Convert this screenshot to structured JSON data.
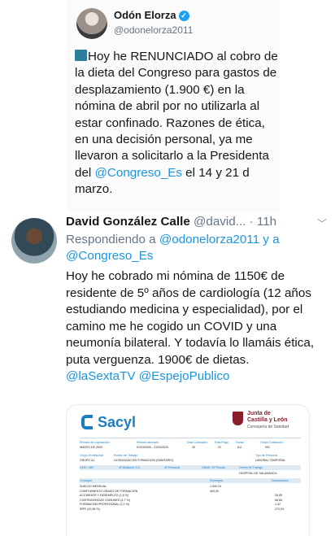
{
  "tweet1": {
    "name": "Odón Elorza",
    "verified": true,
    "handle": "@odonelorza2011",
    "text_before_mention": "Hoy he RENUNCIADO al cobro de la dieta del Congreso para gastos de desplazamiento (1.900 €) en la nómina de abril por no utilizarla al estar confinado. Razones de ética, en una decisión personal, ya me llevaron a solicitarlo a la Presidenta del ",
    "mention": "@Congreso_Es",
    "text_after_mention": " el 14 y 21 d marzo.",
    "icon": "bank-emoji-icon"
  },
  "tweet2": {
    "name": "David González Calle",
    "handle": "@david...",
    "separator": " · ",
    "time": "11h",
    "reply_prefix": "Respondiendo a ",
    "reply_to_1": "@odonelorza2011",
    "reply_joiner": " y a ",
    "reply_to_2": "@Congreso_Es",
    "text": "Hoy he cobrado mi nómina de 1150€ de residente de 5º años de cardiología (12 años estudiando medicina y especialidad), por el camino me he cogido un COVID y una neumonía bilateral. Y todavía lo llamáis ética, puta verguenza. 1900€ de dietas. ",
    "mention_1": "@laSextaTV",
    "mention_2": "@EspejoPublico"
  },
  "payslip": {
    "logo_left": "Sacyl",
    "logo_right_line1": "Junta de",
    "logo_right_line2": "Castilla y León",
    "logo_right_line3": "Consejería de Sanidad",
    "row1_headers": [
      "Periodo de Liquidación",
      "Periodo abonado",
      "Días Cotización",
      "Días Pago",
      "Horas",
      "Grupo Cotización"
    ],
    "row1_values": [
      "MARZO DE 2020",
      "01/03/2020 - 31/03/2020",
      "30",
      "31",
      "8,0",
      "001"
    ],
    "row2_headers": [
      "Grupo Profesional",
      "Puesto de Trabajo",
      "Tipo de Personal"
    ],
    "row2_values": [
      "GRUPO A1",
      "LICENCIADO EN FORMACION (SANITARIO)",
      "LABORAL TEMPORAL"
    ],
    "row3_headers": [
      "CEIC / NIF",
      "Nº Afiliación S.S.",
      "Nº Personal",
      "CNAE / Nº Puesto",
      "Centro de Trabajo"
    ],
    "row3_values": [
      "",
      "",
      "",
      "",
      "HOSPITAL DE SALAMANCA"
    ],
    "concepts_header": "Concepto",
    "devengos_header": "Devengos",
    "deducciones_header": "Deducciones",
    "lines": [
      {
        "concept": "SUELDO MENSUAL",
        "devengo": "1.009,24",
        "deduccion": ""
      },
      {
        "concept": "COMPLEMENTO GRADO DE FORMACION",
        "devengo": "409,50",
        "deduccion": ""
      },
      {
        "concept": "ACCIDENTE Y DESEMPLEO (1,6 %)",
        "devengo": "",
        "deduccion": "26,89"
      },
      {
        "concept": "CONTINGENCIAS COMUNES (4,7 %)",
        "devengo": "",
        "deduccion": "66,65"
      },
      {
        "concept": "FORMACION PROFESIONAL (0,1 %)",
        "devengo": "",
        "deduccion": "1,42"
      },
      {
        "concept": "IRPF (20,38 %)",
        "devengo": "",
        "deduccion": "272,93"
      }
    ]
  }
}
